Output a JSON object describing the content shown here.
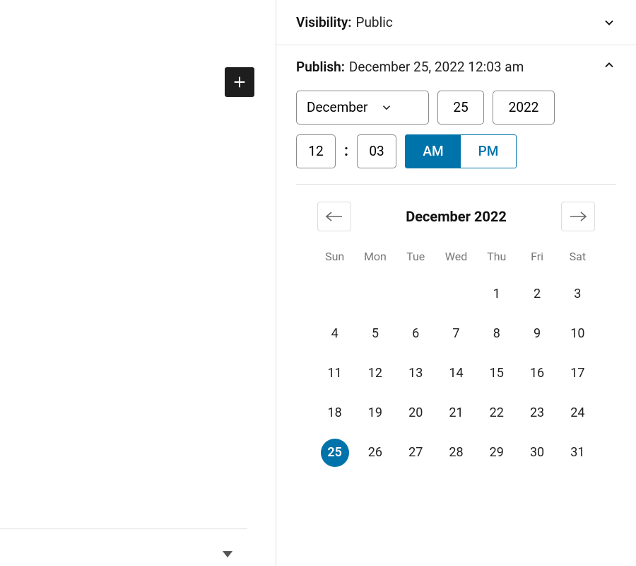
{
  "visibility": {
    "label": "Visibility:",
    "value": "Public"
  },
  "publish": {
    "label": "Publish:",
    "value": "December 25, 2022 12:03 am",
    "month": "December",
    "day": "25",
    "year": "2022",
    "hour": "12",
    "minute": "03",
    "am": "AM",
    "pm": "PM",
    "am_selected": true
  },
  "calendar": {
    "title": "December 2022",
    "weekdays": [
      "Sun",
      "Mon",
      "Tue",
      "Wed",
      "Thu",
      "Fri",
      "Sat"
    ],
    "leading_blanks": 4,
    "days_in_month": 31,
    "selected_day": 25
  },
  "colors": {
    "accent": "#0073aa"
  }
}
